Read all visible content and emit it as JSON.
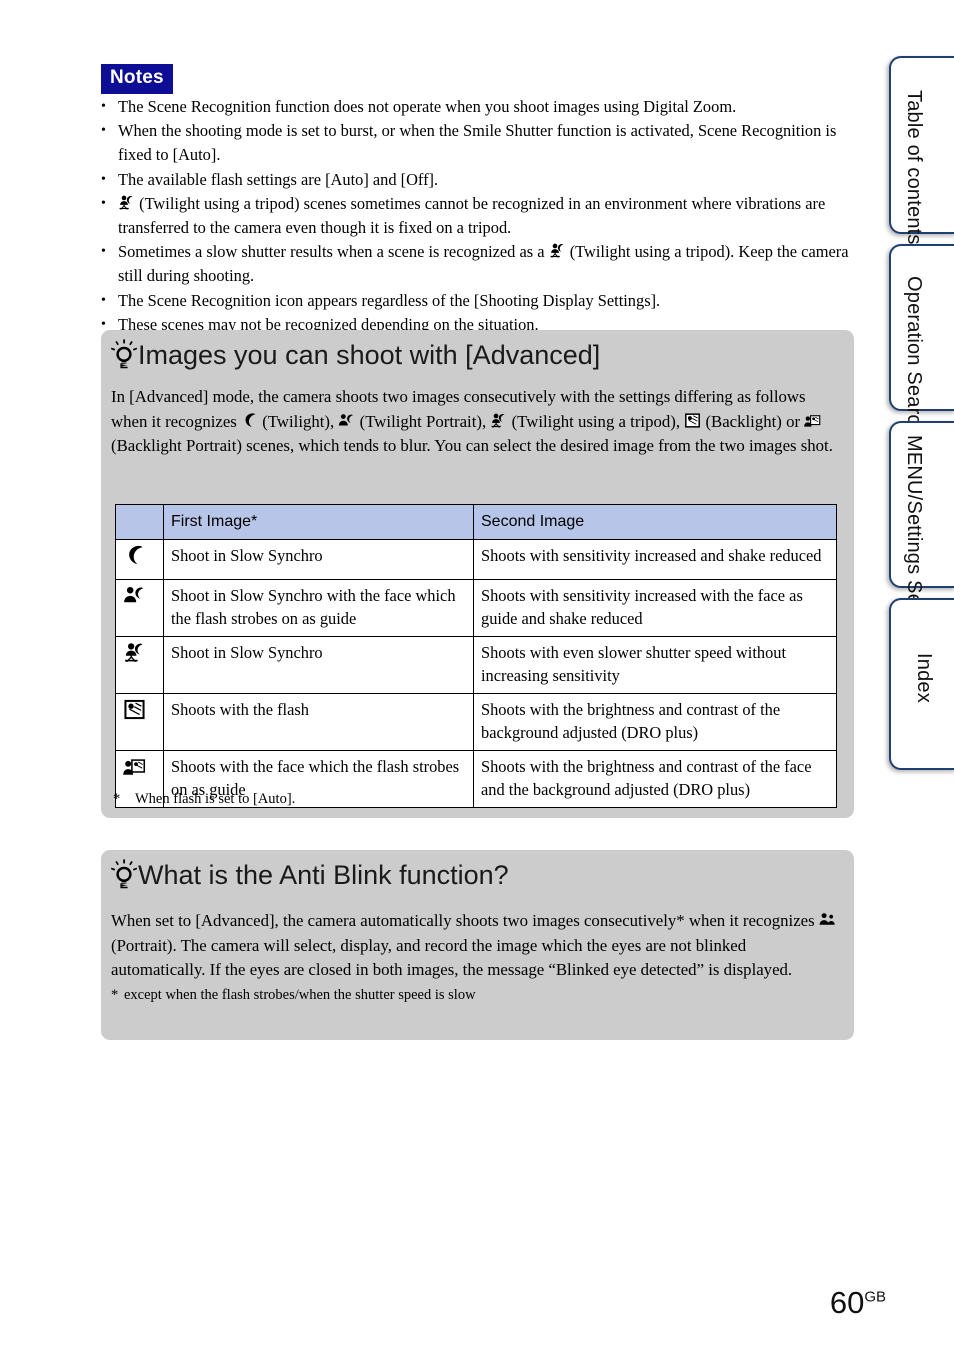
{
  "notes": {
    "badge_label": "Notes",
    "bullets": [
      {
        "text": "The Scene Recognition function does not operate when you shoot images using Digital Zoom."
      },
      {
        "text": "When the shooting mode is set to burst, or when the Smile Shutter function is activated, Scene Recognition is fixed to [Auto]."
      },
      {
        "text": "The available flash settings are [Auto] and [Off]."
      },
      {
        "icon": "twilight-tripod-icon",
        "text_before": "",
        "text": "(Twilight using a tripod) scenes sometimes cannot be recognized in an environment where vibrations are transferred to the camera even though it is fixed on a tripod."
      },
      {
        "text": "Sometimes a slow shutter results when a scene is recognized as a",
        "icon_mid": "twilight-tripod-icon",
        "text_after": "(Twilight using a tripod). Keep the camera still during shooting."
      },
      {
        "text": "The Scene Recognition icon appears regardless of the [Shooting Display Settings]."
      },
      {
        "text": "These scenes may not be recognized depending on the situation."
      }
    ]
  },
  "advanced_panel": {
    "heading": "Images you can shoot with [Advanced]",
    "heading_icon": "lightbulb-icon",
    "body": {
      "part1": "In [Advanced] mode, the camera shoots two images consecutively with the settings differing as follows when it recognizes",
      "label_twilight": "(Twilight),",
      "label_twilight_portrait": "(Twilight Portrait),",
      "label_twilight_tripod": "(Twilight using a tripod),",
      "label_backlight": "(Backlight) or",
      "label_backlight_portrait": "(Backlight Portrait) scenes, which tends to blur.",
      "part2": "You can select the desired image from the two images shot."
    },
    "table": {
      "headers": [
        "",
        "First Image*",
        "Second Image"
      ],
      "rows": [
        {
          "icon": "twilight-icon",
          "first": "Shoot in Slow Synchro",
          "second": "Shoots with sensitivity increased and shake reduced"
        },
        {
          "icon": "twilight-portrait-icon",
          "first": "Shoot in Slow Synchro with the face which the flash strobes on as guide",
          "second": "Shoots with sensitivity increased with the face as guide and shake reduced"
        },
        {
          "icon": "twilight-tripod-icon",
          "first": "Shoot in Slow Synchro",
          "second": "Shoots with even slower shutter speed without increasing sensitivity"
        },
        {
          "icon": "backlight-icon",
          "first": "Shoots with the flash",
          "second": "Shoots with the brightness and contrast of the background adjusted (DRO plus)"
        },
        {
          "icon": "backlight-portrait-icon",
          "first": "Shoots with the face which the flash strobes on as guide",
          "second": "Shoots with the brightness and contrast of the face and the background adjusted (DRO plus)"
        }
      ]
    },
    "footnote_mark": "*",
    "footnote_text": "When flash is set to [Auto]."
  },
  "antiblink_panel": {
    "heading": "What is the Anti Blink function?",
    "heading_icon": "lightbulb-icon",
    "body": {
      "part1": "When set to [Advanced], the camera automatically shoots two images consecutively* when it recognizes",
      "label_portrait": "(Portrait). The camera will select, display, and record the image which the eyes are not blinked automatically. If the eyes are closed in both images, the message “Blinked eye detected” is displayed."
    },
    "footnote_mark": "*",
    "footnote_text": "except when the flash strobes/when the shutter speed is slow"
  },
  "side_tabs": [
    {
      "id": "toc",
      "label": "Table of contents"
    },
    {
      "id": "operation",
      "label": "Operation Search"
    },
    {
      "id": "menu",
      "label": "MENU/Settings Search"
    },
    {
      "id": "index",
      "label": "Index"
    }
  ],
  "page_number": {
    "number": "60",
    "suffix": "GB"
  },
  "colors": {
    "notes_badge_bg": "#0d0d96",
    "panel_bg": "#cccccc",
    "table_header_bg": "#b7c5e9",
    "tab_border": "#1f3f73"
  }
}
